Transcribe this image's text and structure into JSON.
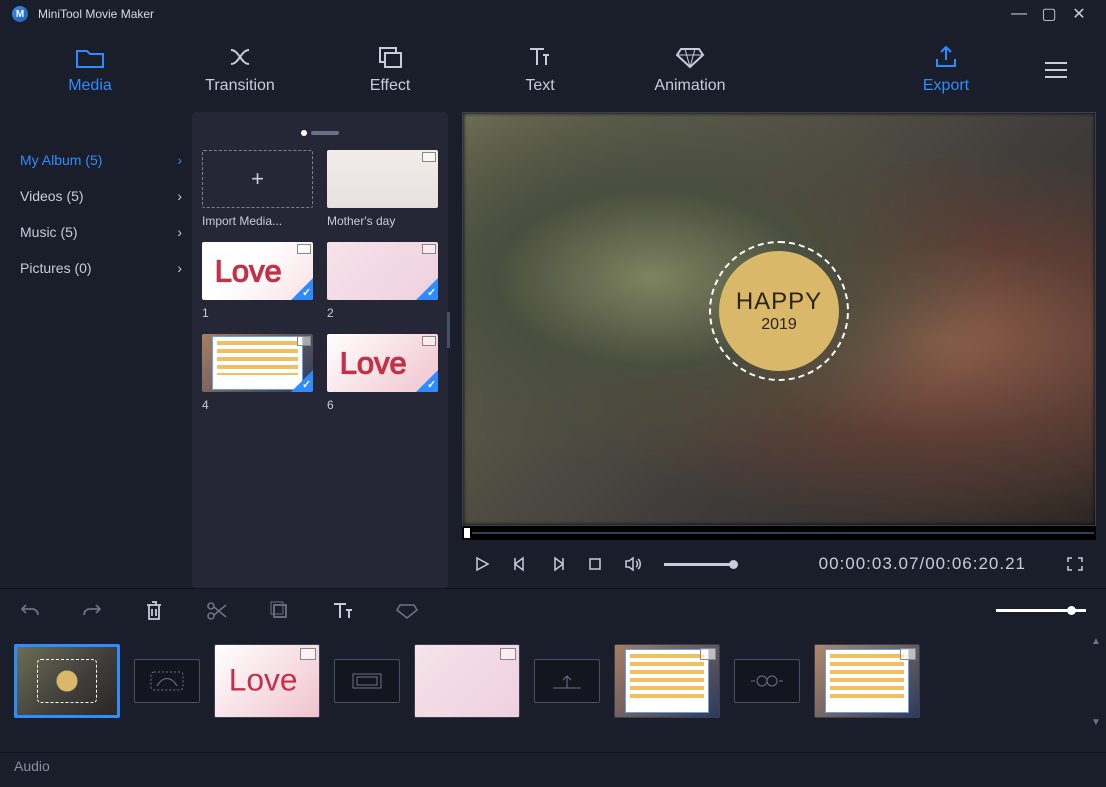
{
  "app": {
    "title": "MiniTool Movie Maker",
    "logo_letter": "M"
  },
  "window": {
    "min": "—",
    "max": "▢",
    "close": "✕"
  },
  "tabs": {
    "media": "Media",
    "transition": "Transition",
    "effect": "Effect",
    "text": "Text",
    "animation": "Animation",
    "export": "Export"
  },
  "sidebar": {
    "items": [
      {
        "label": "My Album (5)",
        "active": true
      },
      {
        "label": "Videos (5)"
      },
      {
        "label": "Music (5)"
      },
      {
        "label": "Pictures (0)"
      }
    ]
  },
  "media": {
    "import_label": "Import Media...",
    "import_plus": "+",
    "items": [
      {
        "label": "Mother's day"
      },
      {
        "label": "1"
      },
      {
        "label": "2"
      },
      {
        "label": "4"
      },
      {
        "label": "6"
      }
    ]
  },
  "preview": {
    "circle_line1": "HAPPY",
    "circle_line2": "2019",
    "time_current": "00:00:03.07",
    "time_sep": "/",
    "time_total": "00:06:20.21"
  },
  "timeline": {
    "audio_label": "Audio"
  }
}
